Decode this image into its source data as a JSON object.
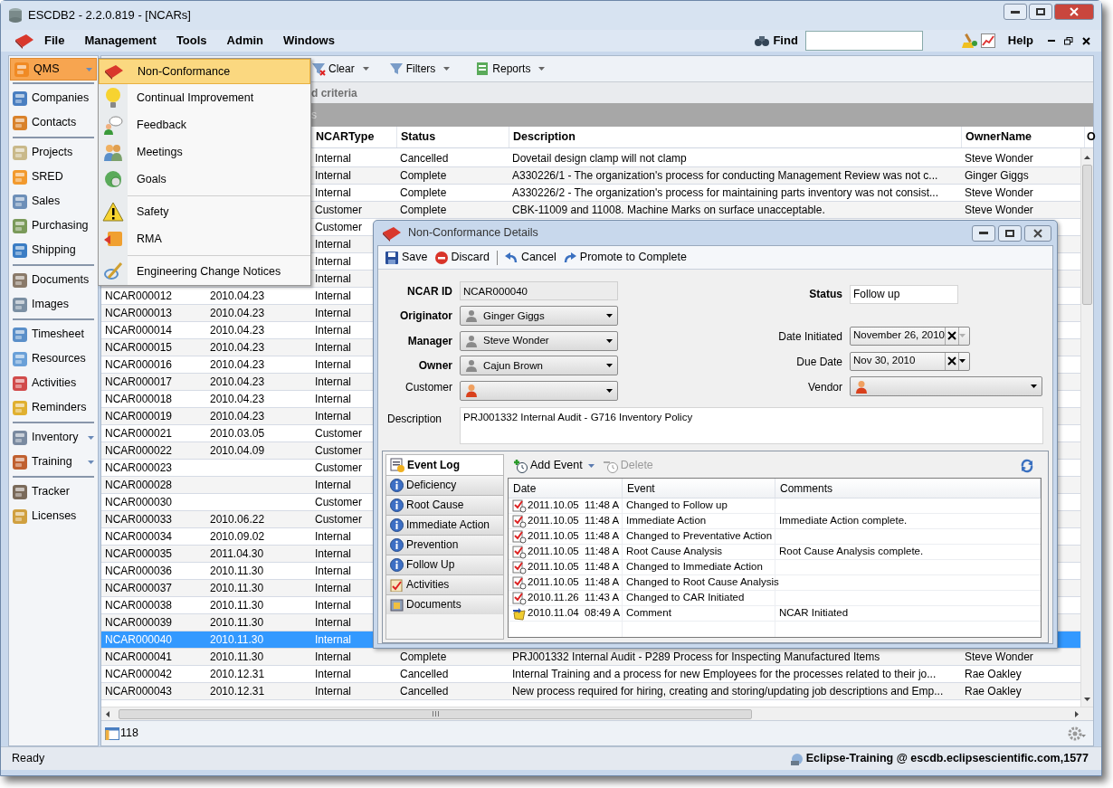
{
  "window": {
    "title": "ESCDB2 - 2.2.0.819 - [NCARs]"
  },
  "menu_bar": {
    "items": [
      "File",
      "Management",
      "Tools",
      "Admin",
      "Windows"
    ],
    "find": "Find",
    "help": "Help"
  },
  "sidebar": {
    "groups": [
      [
        {
          "label": "QMS",
          "selected": true,
          "submenu": true
        }
      ],
      [
        {
          "label": "Companies",
          "selected": false,
          "submenu": false
        },
        {
          "label": "Contacts",
          "selected": false,
          "submenu": false
        }
      ],
      [
        {
          "label": "Projects",
          "selected": false,
          "submenu": false
        },
        {
          "label": "SRED",
          "selected": false,
          "submenu": false
        },
        {
          "label": "Sales",
          "selected": false,
          "submenu": false
        },
        {
          "label": "Purchasing",
          "selected": false,
          "submenu": false
        },
        {
          "label": "Shipping",
          "selected": false,
          "submenu": false
        }
      ],
      [
        {
          "label": "Documents",
          "selected": false,
          "submenu": false
        },
        {
          "label": "Images",
          "selected": false,
          "submenu": false
        }
      ],
      [
        {
          "label": "Timesheet",
          "selected": false,
          "submenu": false
        },
        {
          "label": "Resources",
          "selected": false,
          "submenu": false
        },
        {
          "label": "Activities",
          "selected": false,
          "submenu": false
        },
        {
          "label": "Reminders",
          "selected": false,
          "submenu": false
        }
      ],
      [
        {
          "label": "Inventory",
          "selected": false,
          "submenu": true
        },
        {
          "label": "Training",
          "selected": false,
          "submenu": true
        }
      ],
      [
        {
          "label": "Tracker",
          "selected": false,
          "submenu": false
        },
        {
          "label": "Licenses",
          "selected": false,
          "submenu": false
        }
      ]
    ]
  },
  "toolbar": [
    {
      "label": "Clear",
      "dropdown": true
    },
    {
      "label": "Filters",
      "dropdown": true
    },
    {
      "label": "Reports",
      "dropdown": true
    }
  ],
  "criteria_bar": {
    "text": "d criteria"
  },
  "group_bar": {
    "text": "s"
  },
  "table": {
    "columns": [
      null,
      null,
      "NCARType",
      "Status",
      "Description",
      "OwnerName",
      "O"
    ],
    "rows": [
      {
        "selected": false,
        "cells": [
          null,
          null,
          "Internal",
          "Cancelled",
          "Dovetail design clamp will not clamp",
          "Steve Wonder"
        ]
      },
      {
        "selected": false,
        "cells": [
          null,
          null,
          "Internal",
          "Complete",
          "A330226/1 - The organization's process for conducting Management Review was not c...",
          "Ginger Giggs"
        ]
      },
      {
        "selected": false,
        "cells": [
          null,
          null,
          "Internal",
          "Complete",
          "A330226/2 - The organization's process for maintaining parts inventory was not consist...",
          "Steve Wonder"
        ]
      },
      {
        "selected": false,
        "cells": [
          null,
          null,
          "Customer",
          "Complete",
          "CBK-11009 and 11008. Machine Marks on surface unacceptable.",
          "Steve Wonder"
        ]
      },
      {
        "selected": false,
        "cells": [
          null,
          null,
          "Customer",
          null,
          null,
          null
        ]
      },
      {
        "selected": false,
        "cells": [
          null,
          null,
          "Internal",
          null,
          null,
          null
        ]
      },
      {
        "selected": false,
        "cells": [
          null,
          null,
          "Internal",
          null,
          null,
          null
        ]
      },
      {
        "selected": false,
        "cells": [
          null,
          null,
          "Internal",
          null,
          null,
          null
        ]
      },
      {
        "selected": false,
        "cells": [
          "NCAR000012",
          "2010.04.23",
          "Internal",
          null,
          null,
          null
        ]
      },
      {
        "selected": false,
        "cells": [
          "NCAR000013",
          "2010.04.23",
          "Internal",
          null,
          null,
          null
        ]
      },
      {
        "selected": false,
        "cells": [
          "NCAR000014",
          "2010.04.23",
          "Internal",
          null,
          null,
          null
        ]
      },
      {
        "selected": false,
        "cells": [
          "NCAR000015",
          "2010.04.23",
          "Internal",
          null,
          null,
          null
        ]
      },
      {
        "selected": false,
        "cells": [
          "NCAR000016",
          "2010.04.23",
          "Internal",
          null,
          null,
          null
        ]
      },
      {
        "selected": false,
        "cells": [
          "NCAR000017",
          "2010.04.23",
          "Internal",
          null,
          null,
          null
        ]
      },
      {
        "selected": false,
        "cells": [
          "NCAR000018",
          "2010.04.23",
          "Internal",
          null,
          null,
          null
        ]
      },
      {
        "selected": false,
        "cells": [
          "NCAR000019",
          "2010.04.23",
          "Internal",
          null,
          null,
          null
        ]
      },
      {
        "selected": false,
        "cells": [
          "NCAR000021",
          "2010.03.05",
          "Customer",
          null,
          null,
          null
        ]
      },
      {
        "selected": false,
        "cells": [
          "NCAR000022",
          "2010.04.09",
          "Customer",
          null,
          null,
          null
        ]
      },
      {
        "selected": false,
        "cells": [
          "NCAR000023",
          null,
          "Customer",
          null,
          null,
          null
        ]
      },
      {
        "selected": false,
        "cells": [
          "NCAR000028",
          null,
          "Internal",
          null,
          null,
          null
        ]
      },
      {
        "selected": false,
        "cells": [
          "NCAR000030",
          null,
          "Customer",
          null,
          null,
          null
        ]
      },
      {
        "selected": false,
        "cells": [
          "NCAR000033",
          "2010.06.22",
          "Customer",
          null,
          null,
          null
        ]
      },
      {
        "selected": false,
        "cells": [
          "NCAR000034",
          "2010.09.02",
          "Internal",
          null,
          null,
          null
        ]
      },
      {
        "selected": false,
        "cells": [
          "NCAR000035",
          "2011.04.30",
          "Internal",
          null,
          null,
          null
        ]
      },
      {
        "selected": false,
        "cells": [
          "NCAR000036",
          "2010.11.30",
          "Internal",
          null,
          null,
          null
        ]
      },
      {
        "selected": false,
        "cells": [
          "NCAR000037",
          "2010.11.30",
          "Internal",
          null,
          null,
          null
        ]
      },
      {
        "selected": false,
        "cells": [
          "NCAR000038",
          "2010.11.30",
          "Internal",
          null,
          null,
          null
        ]
      },
      {
        "selected": false,
        "cells": [
          "NCAR000039",
          "2010.11.30",
          "Internal",
          null,
          null,
          null
        ]
      },
      {
        "selected": true,
        "cells": [
          "NCAR000040",
          "2010.11.30",
          "Internal",
          null,
          null,
          null
        ]
      },
      {
        "selected": false,
        "cells": [
          "NCAR000041",
          "2010.11.30",
          "Internal",
          "Complete",
          "PRJ001332 Internal Audit - P289 Process for Inspecting Manufactured Items",
          "Steve Wonder"
        ]
      },
      {
        "selected": false,
        "cells": [
          "NCAR000042",
          "2010.12.31",
          "Internal",
          "Cancelled",
          "Internal Training and a process for new Employees for the processes related to their jo...",
          "Rae Oakley"
        ]
      },
      {
        "selected": false,
        "cells": [
          "NCAR000043",
          "2010.12.31",
          "Internal",
          "Cancelled",
          "New process required for hiring, creating and storing/updating job descriptions and Emp...",
          "Rae Oakley"
        ]
      }
    ]
  },
  "record_count": "118",
  "status_bar": {
    "text": "Ready",
    "connection": "Eclipse-Training @ escdb.eclipsescientific.com,1577"
  },
  "qms_menu": {
    "groups": [
      [
        {
          "label": "Non-Conformance",
          "selected": true
        },
        {
          "label": "Continual Improvement",
          "selected": false
        },
        {
          "label": "Feedback",
          "selected": false
        },
        {
          "label": "Meetings",
          "selected": false
        },
        {
          "label": "Goals",
          "selected": false
        }
      ],
      [
        {
          "label": "Safety",
          "selected": false
        },
        {
          "label": "RMA",
          "selected": false
        }
      ],
      [
        {
          "label": "Engineering Change Notices",
          "selected": false
        }
      ]
    ]
  },
  "dialog": {
    "title": "Non-Conformance Details",
    "toolbar": [
      {
        "label": "Save",
        "kind": "save"
      },
      {
        "label": "Discard",
        "kind": "discard"
      },
      {
        "label": "Cancel",
        "kind": "undo"
      },
      {
        "label": "Promote to Complete",
        "kind": "redo"
      }
    ],
    "left_fields": [
      {
        "label": "NCAR ID",
        "required": true,
        "kind": "text",
        "readonly": true,
        "value": "NCAR000040"
      },
      {
        "label": "Originator",
        "required": true,
        "kind": "person",
        "value": "Ginger Giggs"
      },
      {
        "label": "Manager",
        "required": true,
        "kind": "person",
        "value": "Steve Wonder"
      },
      {
        "label": "Owner",
        "required": true,
        "kind": "person",
        "value": "Cajun Brown"
      },
      {
        "label": "Customer",
        "required": false,
        "kind": "contact"
      }
    ],
    "right_fields": [
      {
        "label": "Status",
        "required": true,
        "kind": "text",
        "readonly": false,
        "value": "Follow up"
      },
      {
        "label": "Date Initiated",
        "required": false,
        "kind": "date",
        "dropdown_enabled": false,
        "value": "November 26, 2010"
      },
      {
        "label": "Due Date",
        "required": false,
        "kind": "date",
        "dropdown_enabled": true,
        "value": "Nov 30, 2010"
      },
      {
        "label": "Vendor",
        "required": false,
        "kind": "contact"
      }
    ],
    "description": {
      "label": "Description",
      "value": "PRJ001332 Internal Audit - G716 Inventory Policy"
    },
    "tabs": [
      {
        "label": "Event Log",
        "selected": true,
        "kind": "log"
      },
      {
        "label": "Deficiency",
        "selected": false,
        "kind": "info"
      },
      {
        "label": "Root Cause",
        "selected": false,
        "kind": "info"
      },
      {
        "label": "Immediate Action",
        "selected": false,
        "kind": "info"
      },
      {
        "label": "Prevention",
        "selected": false,
        "kind": "info"
      },
      {
        "label": "Follow Up",
        "selected": false,
        "kind": "info"
      },
      {
        "label": "Activities",
        "selected": false,
        "kind": "checklist"
      },
      {
        "label": "Documents",
        "selected": false,
        "kind": "document"
      }
    ],
    "event_toolbar": [
      {
        "label": "Add Event",
        "disabled": false,
        "dropdown": true
      },
      {
        "label": "Delete",
        "disabled": true,
        "dropdown": false
      }
    ],
    "events": {
      "columns": [
        "Date",
        "Event",
        "Comments"
      ],
      "rows": [
        {
          "kind": "change",
          "date": "2011.10.05  11:48 A",
          "event": "Changed to Follow up"
        },
        {
          "kind": "change",
          "date": "2011.10.05  11:48 A",
          "event": "Immediate Action",
          "comments": "Immediate Action complete."
        },
        {
          "kind": "change",
          "date": "2011.10.05  11:48 A",
          "event": "Changed to Preventative Action"
        },
        {
          "kind": "change",
          "date": "2011.10.05  11:48 A",
          "event": "Root Cause Analysis",
          "comments": "Root Cause Analysis complete."
        },
        {
          "kind": "change",
          "date": "2011.10.05  11:48 A",
          "event": "Changed to Immediate Action"
        },
        {
          "kind": "change",
          "date": "2011.10.05  11:48 A",
          "event": "Changed to Root Cause Analysis"
        },
        {
          "kind": "change",
          "date": "2010.11.26  11:43 A",
          "event": "Changed to CAR Initiated"
        },
        {
          "kind": "comment",
          "date": "2010.11.04  08:49 A",
          "event": "Comment",
          "comments": "NCAR Initiated"
        }
      ]
    }
  }
}
